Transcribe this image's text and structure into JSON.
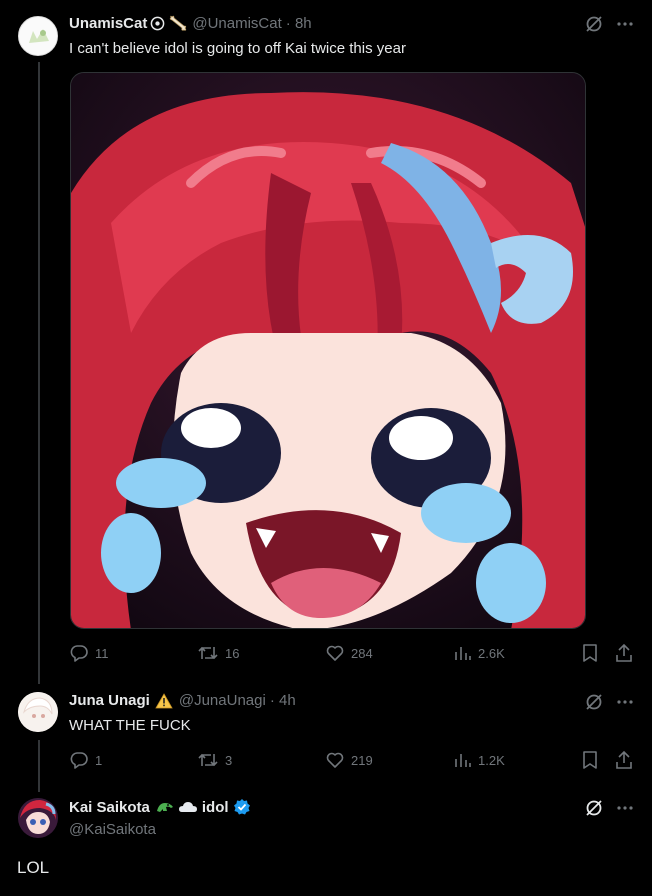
{
  "tweets": [
    {
      "name": "UnamisCat",
      "handle": "@UnamisCat",
      "time": "· 8h",
      "text": "I can't believe idol is going to off Kai twice this year",
      "replies": "11",
      "reposts": "16",
      "likes": "284",
      "views": "2.6K"
    },
    {
      "name": "Juna Unagi",
      "handle": "@JunaUnagi",
      "time": "· 4h",
      "text": "WHAT THE FUCK",
      "replies": "1",
      "reposts": "3",
      "likes": "219",
      "views": "1.2K"
    },
    {
      "name": "Kai Saikota",
      "name_suffix": "idol",
      "handle": "@KaiSaikota",
      "text": "LOL"
    }
  ],
  "icons": {
    "grok": "grok-icon",
    "more": "more-icon",
    "reply": "reply-icon",
    "repost": "repost-icon",
    "like": "heart-icon",
    "views": "views-icon",
    "bookmark": "bookmark-icon",
    "share": "share-icon",
    "verified": "verified-badge-icon",
    "warning": "warning-icon"
  },
  "colors": {
    "background": "#000000",
    "primary_text": "#e7e9ea",
    "secondary_text": "#71767b",
    "verified": "#1d9bf0"
  }
}
